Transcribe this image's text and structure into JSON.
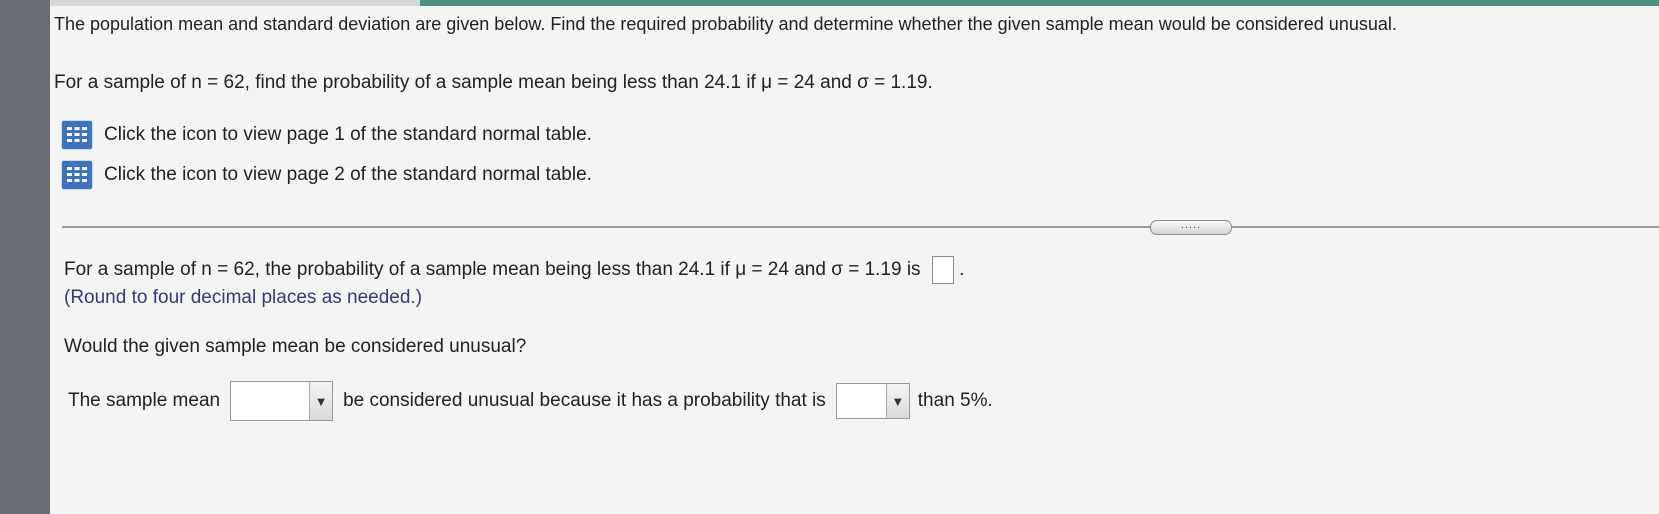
{
  "instruction": "The population mean and standard deviation are given below. Find the required probability and determine whether the given sample mean would be considered unusual.",
  "question": "For a sample of n = 62, find the probability of a sample mean being less than 24.1 if μ = 24 and σ = 1.19.",
  "table_links": [
    {
      "label": "Click the icon to view page 1 of the standard normal table.",
      "icon": "table-grid-icon"
    },
    {
      "label": "Click the icon to view page 2 of the standard normal table.",
      "icon": "table-grid-icon"
    }
  ],
  "divider_handle": ".....",
  "answer": {
    "prompt": "For a sample of n = 62, the probability of a sample mean being less than 24.1 if μ = 24 and σ = 1.19 is",
    "value": "",
    "suffix": ".",
    "note": "(Round to four decimal places as needed.)"
  },
  "unusual_question": "Would the given sample mean be considered unusual?",
  "conclusion": {
    "part1": "The sample mean",
    "dropdown1_value": "",
    "part2": "be considered unusual because it has a probability that is",
    "dropdown2_value": "",
    "part3": "than 5%."
  },
  "colors": {
    "icon_blue": "#3c73c4",
    "note_text": "#343b74",
    "top_band": "#4f8f80"
  }
}
